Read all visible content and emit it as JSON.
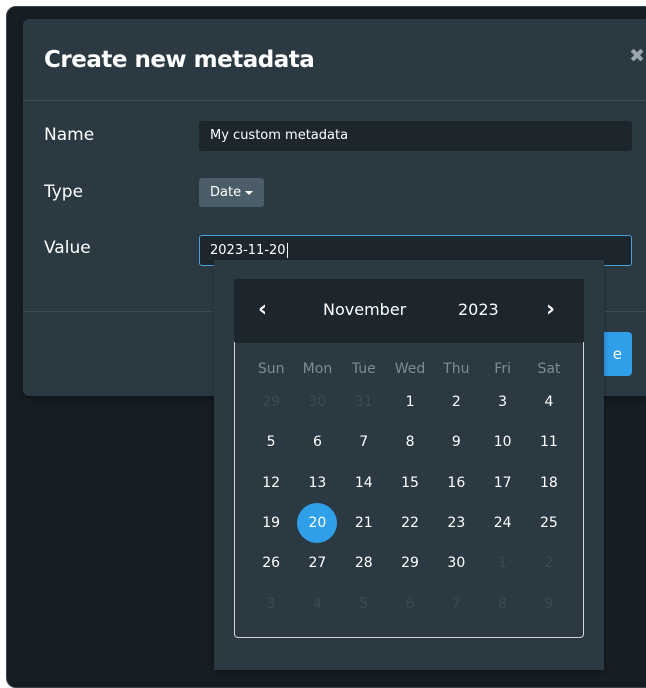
{
  "dialog": {
    "title": "Create new metadata",
    "close_glyph": "✖",
    "fields": {
      "name_label": "Name",
      "name_value": "My custom metadata",
      "type_label": "Type",
      "type_value": "Date",
      "value_label": "Value",
      "value_value": "2023-11-20"
    },
    "save_label_partial": "e"
  },
  "datepicker": {
    "prev_glyph": "‹",
    "next_glyph": "›",
    "month": "November",
    "year": "2023",
    "weekdays": [
      "Sun",
      "Mon",
      "Tue",
      "Wed",
      "Thu",
      "Fri",
      "Sat"
    ],
    "selected_day": "20",
    "weeks": [
      [
        {
          "d": "29",
          "m": true
        },
        {
          "d": "30",
          "m": true
        },
        {
          "d": "31",
          "m": true
        },
        {
          "d": "1"
        },
        {
          "d": "2"
        },
        {
          "d": "3"
        },
        {
          "d": "4"
        }
      ],
      [
        {
          "d": "5"
        },
        {
          "d": "6"
        },
        {
          "d": "7"
        },
        {
          "d": "8"
        },
        {
          "d": "9"
        },
        {
          "d": "10"
        },
        {
          "d": "11"
        }
      ],
      [
        {
          "d": "12"
        },
        {
          "d": "13"
        },
        {
          "d": "14"
        },
        {
          "d": "15"
        },
        {
          "d": "16"
        },
        {
          "d": "17"
        },
        {
          "d": "18"
        }
      ],
      [
        {
          "d": "19"
        },
        {
          "d": "20",
          "s": true
        },
        {
          "d": "21"
        },
        {
          "d": "22"
        },
        {
          "d": "23"
        },
        {
          "d": "24"
        },
        {
          "d": "25"
        }
      ],
      [
        {
          "d": "26"
        },
        {
          "d": "27"
        },
        {
          "d": "28"
        },
        {
          "d": "29"
        },
        {
          "d": "30"
        },
        {
          "d": "1",
          "m": true
        },
        {
          "d": "2",
          "m": true
        }
      ],
      [
        {
          "d": "3",
          "m": true
        },
        {
          "d": "4",
          "m": true
        },
        {
          "d": "5",
          "m": true
        },
        {
          "d": "6",
          "m": true
        },
        {
          "d": "7",
          "m": true
        },
        {
          "d": "8",
          "m": true
        },
        {
          "d": "9",
          "m": true
        }
      ]
    ]
  },
  "colors": {
    "background": "#161d23",
    "modal": "#2b3942",
    "input": "#1d262d",
    "accent": "#2f9fea",
    "muted_day": "#3d4a53"
  }
}
